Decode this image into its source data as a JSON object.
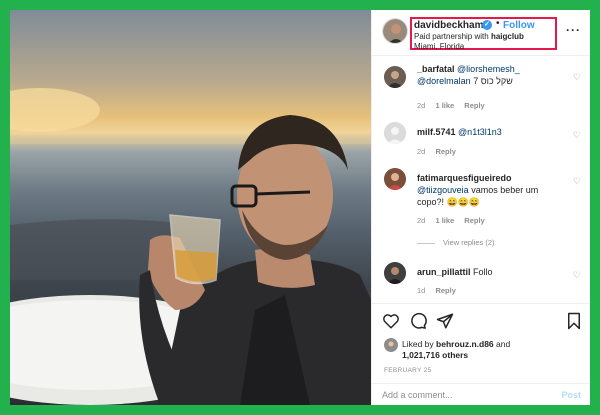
{
  "header": {
    "username": "davidbeckham",
    "verified_glyph": "✓",
    "separator": "•",
    "follow_label": "Follow",
    "paid_prefix": "Paid partnership with",
    "partner": "haigclub",
    "location": "Miami, Florida",
    "more_glyph": "···"
  },
  "comments": [
    {
      "username": "_barfatal",
      "text_mention1": "@liorshemesh_",
      "text_mention2": "@dorelmalan",
      "text": "שקל כוס 7",
      "age": "2d",
      "likes": "1 like",
      "reply": "Reply"
    },
    {
      "username": "milf.5741",
      "text_mention1": "@n1t3l1n3",
      "age": "2d",
      "reply": "Reply"
    },
    {
      "username": "fatimarquesfigueiredo",
      "text_mention1": "@tiizgouveia",
      "text": "vamos beber um copo?! 😄😄😄",
      "age": "2d",
      "likes": "1 like",
      "reply": "Reply",
      "view_replies": "View replies (2)"
    },
    {
      "username": "arun_pillattil",
      "text": "Follo",
      "age": "1d",
      "reply": "Reply"
    }
  ],
  "actions": {
    "liked_prefix": "Liked by",
    "liked_user": "behrouz.n.d86",
    "liked_and": "and",
    "others_count": "1,021,716 others",
    "date": "FEBRUARY 25"
  },
  "add_comment": {
    "placeholder": "Add a comment...",
    "post_label": "Post"
  },
  "colors": {
    "border": "#22b14c",
    "highlight": "#e5194a",
    "accent": "#3897f0"
  },
  "icons": {
    "like": "heart-icon",
    "comment": "comment-icon",
    "share": "share-icon",
    "save": "bookmark-icon"
  }
}
